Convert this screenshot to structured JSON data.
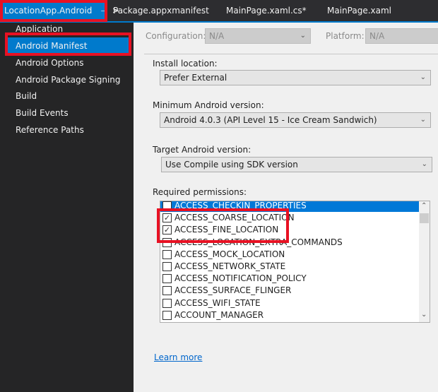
{
  "tabs": [
    {
      "label": "LocationApp.Android",
      "pin_icon": "⊣",
      "arrow_icon": ">"
    },
    {
      "label": "Package.appxmanifest"
    },
    {
      "label": "MainPage.xaml.cs*"
    },
    {
      "label": "MainPage.xaml"
    }
  ],
  "sidebar": {
    "items": [
      {
        "label": "Application"
      },
      {
        "label": "Android Manifest"
      },
      {
        "label": "Android Options"
      },
      {
        "label": "Android Package Signing"
      },
      {
        "label": "Build"
      },
      {
        "label": "Build Events"
      },
      {
        "label": "Reference Paths"
      }
    ]
  },
  "config": {
    "configuration_label": "Configuration:",
    "configuration_value": "N/A",
    "platform_label": "Platform:",
    "platform_value": "N/A"
  },
  "form": {
    "install_location_label": "Install location:",
    "install_location_value": "Prefer External",
    "min_version_label": "Minimum Android version:",
    "min_version_value": "Android 4.0.3 (API Level 15 - Ice Cream Sandwich)",
    "target_version_label": "Target Android version:",
    "target_version_value": "Use Compile using SDK version",
    "permissions_label": "Required permissions:"
  },
  "permissions": [
    {
      "name": "ACCESS_CHECKIN_PROPERTIES",
      "checked": false
    },
    {
      "name": "ACCESS_COARSE_LOCATION",
      "checked": true
    },
    {
      "name": "ACCESS_FINE_LOCATION",
      "checked": true
    },
    {
      "name": "ACCESS_LOCATION_EXTRA_COMMANDS",
      "checked": false
    },
    {
      "name": "ACCESS_MOCK_LOCATION",
      "checked": false
    },
    {
      "name": "ACCESS_NETWORK_STATE",
      "checked": false
    },
    {
      "name": "ACCESS_NOTIFICATION_POLICY",
      "checked": false
    },
    {
      "name": "ACCESS_SURFACE_FLINGER",
      "checked": false
    },
    {
      "name": "ACCESS_WIFI_STATE",
      "checked": false
    },
    {
      "name": "ACCOUNT_MANAGER",
      "checked": false
    }
  ],
  "learn_more": "Learn more",
  "colors": {
    "accent": "#007acc",
    "highlight": "#e81123"
  }
}
